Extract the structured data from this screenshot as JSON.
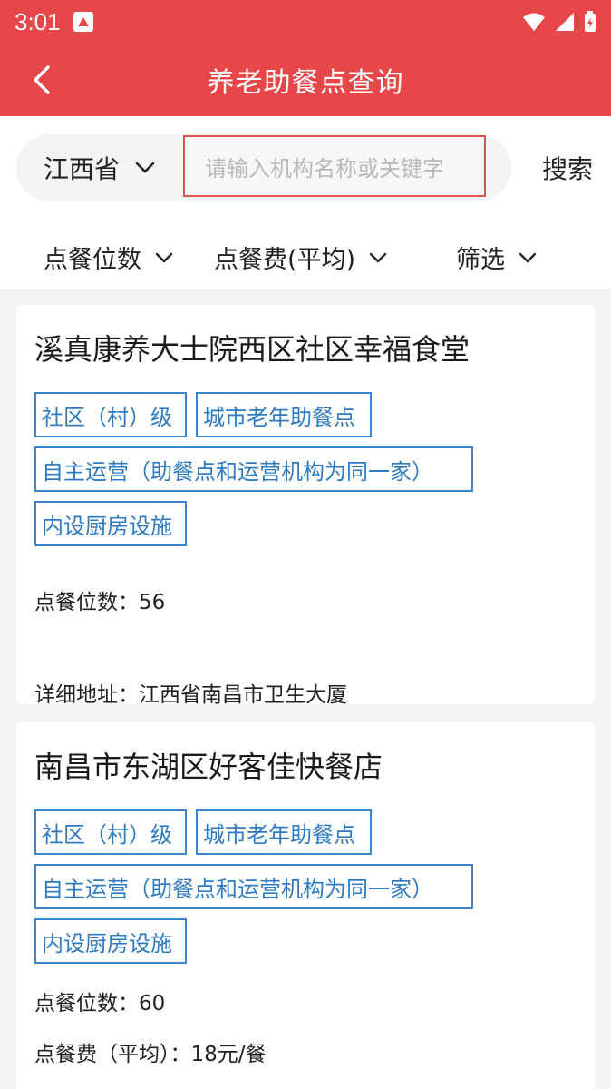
{
  "status_bar": {
    "time": "3:01"
  },
  "header": {
    "title": "养老助餐点查询"
  },
  "search": {
    "province": "江西省",
    "placeholder": "请输入机构名称或关键字",
    "button_label": "搜索"
  },
  "filters": [
    {
      "label": "点餐位数"
    },
    {
      "label": "点餐费(平均)"
    },
    {
      "label": "筛选"
    }
  ],
  "cards": [
    {
      "name": "溪真康养大士院西区社区幸福食堂",
      "tags": [
        "社区（村）级",
        "城市老年助餐点",
        "自主运营（助餐点和运营机构为同一家）",
        "内设厨房设施"
      ],
      "seats": "点餐位数：56",
      "address": "详细地址：江西省南昌市卫生大厦"
    },
    {
      "name": "南昌市东湖区好客佳快餐店",
      "tags": [
        "社区（村）级",
        "城市老年助餐点",
        "自主运营（助餐点和运营机构为同一家）",
        "内设厨房设施"
      ],
      "seats": "点餐位数：60",
      "fee": "点餐费（平均）：18元/餐"
    }
  ],
  "colors": {
    "header_bg": "#e8474a",
    "tag_border": "#3b86c9",
    "input_border": "#e0524e"
  }
}
